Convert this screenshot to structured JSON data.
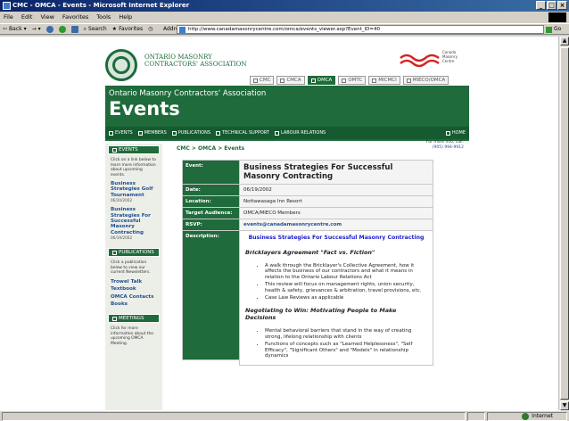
{
  "window": {
    "title": "CMC - OMCA - Events - Microsoft Internet Explorer"
  },
  "menu": [
    "File",
    "Edit",
    "View",
    "Favorites",
    "Tools",
    "Help"
  ],
  "toolbar": {
    "back": "Back",
    "forward": "→",
    "search": "Search",
    "favorites": "Favorites",
    "address_label": "Address",
    "go": "Go"
  },
  "address": {
    "url": "http://www.canadamasonrycentre.com/omca/events_viewer.asp?Event_ID=40"
  },
  "status": {
    "zone": "Internet"
  },
  "site": {
    "org_line1": "ONTARIO MASONRY",
    "org_line2": "CONTRACTORS' ASSOCIATION",
    "canada_center": "Canada Masonry Centre",
    "tabs": [
      "CMC",
      "CMCA",
      "OMCA",
      "OMTC",
      "MICMCI",
      "MIECO/OMCA"
    ],
    "banner_sub": "Ontario Masonry Contractors' Association",
    "banner_title": "Events",
    "nav": [
      "EVENTS",
      "MEMBERS",
      "PUBLICATIONS",
      "TECHNICAL SUPPORT",
      "LABOUR RELATIONS",
      "HOME"
    ]
  },
  "sidebar": {
    "events_head": "EVENTS",
    "events_text": "Click on a link below to learn more information about upcoming events.",
    "events_items": [
      {
        "label": "Business Strategies Golf Tournament",
        "date": "06/20/2002"
      },
      {
        "label": "Business Strategies For Successful Masonry Contracting",
        "date": "06/19/2002"
      }
    ],
    "pubs_head": "PUBLICATIONS",
    "pubs_text": "Click a publication below to view our current Newsletters.",
    "pubs_items": [
      "Trowel Talk",
      "Textbook",
      "OMCA Contacts",
      "Books"
    ],
    "meet_head": "MEETINGS",
    "meet_text": "Click for more information about the upcoming OMCA Meeting."
  },
  "breadcrumb": "CMC > OMCA > Events",
  "more_info": {
    "line1": "For more info, call:",
    "phone": "(905) 994-9912"
  },
  "event": {
    "labels": {
      "event": "Event:",
      "date": "Date:",
      "location": "Location:",
      "audience": "Target Audience:",
      "rsvp": "RSVP:",
      "description": "Description:"
    },
    "title": "Business Strategies For Successful Masonry Contracting",
    "date": "06/19/2002",
    "location": "Nottawasaga Inn Resort",
    "audience": "OMCA/MIECO Members",
    "rsvp": "events@canadamasonrycentre.com",
    "desc_title": "Business Strategies For Successful Masonry Contracting",
    "section1": "Bricklayers Agreement \"Fact vs. Fiction\"",
    "section1_items": [
      "A walk through the Bricklayer's Collective Agreement, how it affects the business of our contractors and what it means in relation to the Ontario Labour Relations Act",
      "This review will focus on management rights, union security, health & safety, grievances & arbitration, travel provisions, etc.",
      "Case Law Reviews as applicable"
    ],
    "section2": "Negotiating to Win: Motivating People to Make Decisions",
    "section2_items": [
      "Mental behavioral barriers that stand in the way of creating strong, lifelong relationship with clients",
      "Functions of concepts such as \"Learned Helplessness\", \"Self Efficacy\", \"Significant Others\" and \"Models\" in relationship dynamics"
    ]
  }
}
